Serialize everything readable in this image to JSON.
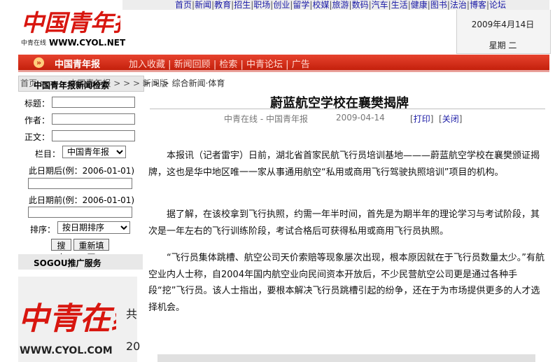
{
  "header": {
    "logo_text": "中国青年报",
    "logo_sub": "中青在线",
    "logo_url": "WWW.CYOL.NET",
    "nav_links": [
      "首页",
      "新闻",
      "教育",
      "招生",
      "职场",
      "创业",
      "留学",
      "校媒",
      "旅游",
      "数码",
      "汽车",
      "生活",
      "健康",
      "图书",
      "法治",
      "博客",
      "论坛"
    ],
    "date": "2009年4月14日",
    "weekday": "星期 二"
  },
  "redbar": {
    "title": "中国青年报",
    "links": [
      "加入收藏",
      "新闻回顾",
      "检索",
      "中青论坛",
      "广告"
    ]
  },
  "breadcrumb": {
    "text": "首页 > > > 中国青年报 > > > 新闻版",
    "box_label": "中国青年报新闻检索",
    "tail": "> > > 综合新闻·体育"
  },
  "search": {
    "title_label": "标题：",
    "author_label": "作者：",
    "body_label": "正文：",
    "column_label": "栏目：",
    "column_value": "中国青年报",
    "after_label": "此日期后(例：2006-01-01)",
    "before_label": "此日期前(例：2006-01-01)",
    "sort_label": "排序：",
    "sort_value": "按日期排序",
    "search_button": "搜索",
    "reset_button": "重新填写"
  },
  "sidebar": {
    "sogou": "SOGOU推广服务",
    "cyol_logo": "中青在线",
    "cyol_url": "WWW.CYOL.COM",
    "cut_text_1": "共",
    "cut_text_2": "20"
  },
  "article": {
    "title": "蔚蓝航空学校在襄樊揭牌",
    "source": "中青在线 - 中国青年报",
    "date": "2009-04-14",
    "print_label": "打印",
    "close_label": "关闭",
    "paragraphs": [
      "本报讯（记者雷宇）日前，湖北省首家民航飞行员培训基地———蔚蓝航空学校在襄樊颁证揭牌，这也是华中地区唯一一家从事通用航空“私用或商用飞行驾驶执照培训”项目的机构。",
      "据了解，在该校拿到飞行执照，约需一年半时间，首先是为期半年的理论学习与考试阶段，其次是一年左右的飞行训练阶段，考试合格后可获得私用或商用飞行员执照。",
      "“飞行员集体跳槽、航空公司天价索赔等现象屡次出现，根本原因就在于飞行员数量太少。”有航空业内人士称，自2004年国内航空业向民间资本开放后，不少民营航空公司更是通过各种手段“挖”飞行员。该人士指出，要根本解决飞行员跳槽引起的纷争，还在于为市场提供更多的人才选择机会。"
    ]
  },
  "colors": {
    "brand_red": "#c4200c",
    "link_blue": "#1a1aa6"
  }
}
